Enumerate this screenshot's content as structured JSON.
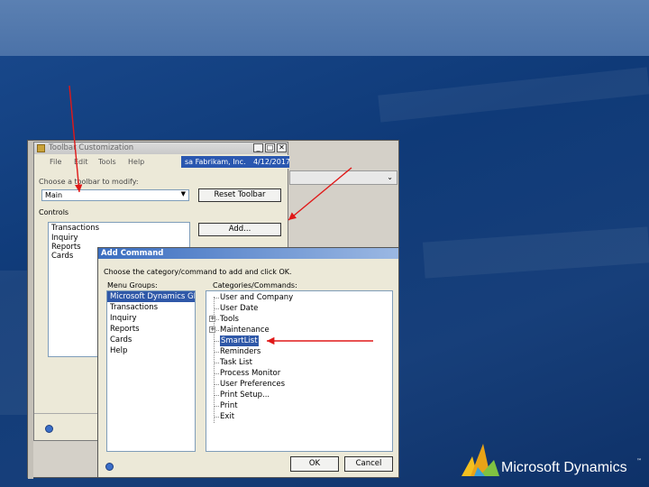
{
  "background": {
    "colors": {
      "top_band": "#5b80b2",
      "deep": "#0f3a78"
    }
  },
  "toolbar_window": {
    "title": "Toolbar Customization",
    "menu": [
      "File",
      "Edit",
      "Tools",
      "Help"
    ],
    "company_label": "sa  Fabrikam, Inc.",
    "date_label": "4/12/2017",
    "choose_label": "Choose a toolbar to modify:",
    "toolbar_value": "Main",
    "reset_button": "Reset Toolbar",
    "controls_label": "Controls",
    "controls": [
      "Transactions",
      "Inquiry",
      "Reports",
      "Cards"
    ],
    "add_button": "Add..."
  },
  "add_command": {
    "title": "Add Command",
    "instruction": "Choose the category/command to add and click OK.",
    "menu_groups_label": "Menu Groups:",
    "categories_label": "Categories/Commands:",
    "menu_groups": [
      "Microsoft Dynamics GP",
      "Transactions",
      "Inquiry",
      "Reports",
      "Cards",
      "Help"
    ],
    "selected_group_index": 0,
    "commands": [
      {
        "label": "User and Company",
        "expander": ""
      },
      {
        "label": "User Date",
        "expander": ""
      },
      {
        "label": "Tools",
        "expander": "+"
      },
      {
        "label": "Maintenance",
        "expander": "+"
      },
      {
        "label": "SmartList",
        "expander": "",
        "selected": true
      },
      {
        "label": "Reminders",
        "expander": ""
      },
      {
        "label": "Task List",
        "expander": ""
      },
      {
        "label": "Process Monitor",
        "expander": ""
      },
      {
        "label": "User Preferences",
        "expander": ""
      },
      {
        "label": "Print Setup...",
        "expander": ""
      },
      {
        "label": "Print",
        "expander": ""
      },
      {
        "label": "Exit",
        "expander": ""
      }
    ],
    "ok_button": "OK",
    "cancel_button": "Cancel"
  },
  "annotations": {
    "arrow_color": "#e01818"
  },
  "logo": {
    "text": "Microsoft Dynamics",
    "trademark": "™"
  }
}
